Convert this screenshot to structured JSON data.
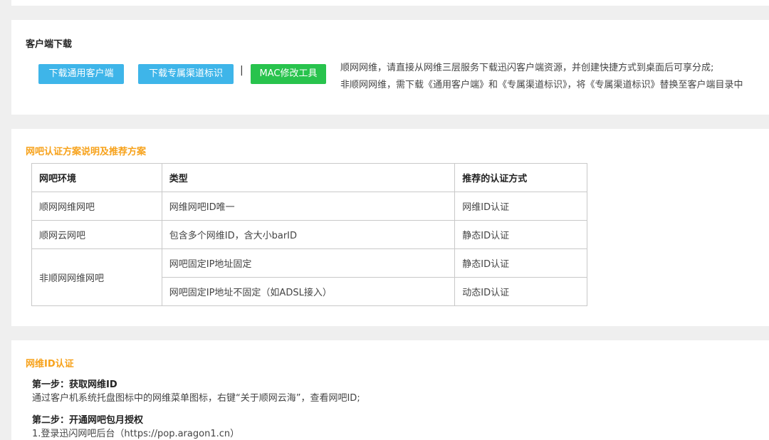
{
  "download": {
    "title": "客户端下载",
    "btn_general": "下载通用客户端",
    "btn_channel": "下载专属渠道标识",
    "separator": "|",
    "btn_mac": "MAC修改工具",
    "line1": "顺网网维，请直接从网维三层服务下载迅闪客户端资源，并创建快捷方式到桌面后可享分成;",
    "line2": "非顺网网维，需下载《通用客户端》和《专属渠道标识》，将《专属渠道标识》替换至客户端目录中",
    "colors": {
      "button_blue": "#3eb5e9",
      "button_green": "#28c34d"
    }
  },
  "scheme": {
    "title": "网吧认证方案说明及推荐方案",
    "title_color": "#f7a21b",
    "headers": [
      "网吧环境",
      "类型",
      "推荐的认证方式"
    ],
    "rows": [
      {
        "env": "顺网网维网吧",
        "type": "网维网吧ID唯一",
        "auth": "网维ID认证"
      },
      {
        "env": "顺网云网吧",
        "type": "包含多个网维ID，含大小barID",
        "auth": "静态ID认证"
      },
      {
        "env": "非顺网网维网吧",
        "type": "网吧固定IP地址固定",
        "auth": "静态ID认证"
      },
      {
        "type": "网吧固定IP地址不固定（如ADSL接入）",
        "auth": "动态ID认证"
      }
    ]
  },
  "netid": {
    "title": "网维ID认证",
    "step1_title": "第一步：获取网维ID",
    "step1_text": "通过客户机系统托盘图标中的网维菜单图标，右键“关于顺网云海”，查看网吧ID;",
    "step2_title": "第二步：开通网吧包月授权",
    "step2_text": "1.登录迅闪网吧后台（https://pop.aragon1.cn）"
  }
}
